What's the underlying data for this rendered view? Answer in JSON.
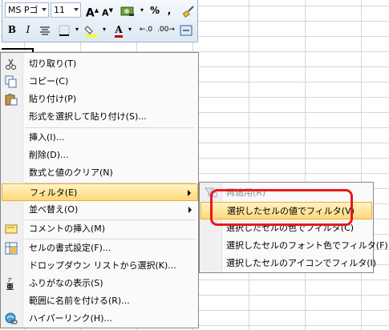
{
  "mini_toolbar": {
    "font_name": "MS Pゴ",
    "font_size": "11",
    "bold": "B",
    "italic": "I",
    "font_color_letter": "A",
    "grow_font": "A",
    "shrink_font": "A",
    "percent": "%",
    "comma": ","
  },
  "context_menu": {
    "items": [
      {
        "label": "切り取り(T)",
        "icon": "scissors-icon"
      },
      {
        "label": "コピー(C)",
        "icon": "copy-icon"
      },
      {
        "label": "貼り付け(P)",
        "icon": "paste-icon"
      },
      {
        "label": "形式を選択して貼り付け(S)..."
      },
      {
        "label": "挿入(I)..."
      },
      {
        "label": "削除(D)..."
      },
      {
        "label": "数式と値のクリア(N)"
      },
      {
        "label": "フィルタ(E)",
        "submenu": true
      },
      {
        "label": "並べ替え(O)",
        "submenu": true
      },
      {
        "label": "コメントの挿入(M)",
        "icon": "comment-icon"
      },
      {
        "label": "セルの書式設定(F)...",
        "icon": "format-cells-icon"
      },
      {
        "label": "ドロップダウン リストから選択(K)..."
      },
      {
        "label": "ふりがなの表示(S)",
        "icon": "phonetic-icon"
      },
      {
        "label": "範囲に名前を付ける(R)..."
      },
      {
        "label": "ハイパーリンク(H)...",
        "icon": "hyperlink-icon"
      }
    ]
  },
  "filter_submenu": {
    "items": [
      {
        "label": "再適用(R)",
        "disabled": true,
        "icon": "reapply-filter-icon"
      },
      {
        "label": "選択したセルの値でフィルタ(V)",
        "highlighted": true
      },
      {
        "label": "選択したセルの色でフィルタ(C)"
      },
      {
        "label": "選択したセルのフォント色でフィルタ(F)"
      },
      {
        "label": "選択したセルのアイコンでフィルタ(I)"
      }
    ]
  },
  "colors": {
    "highlight": "#ffd87a",
    "annotation": "#e8181c",
    "font_color_bar": "#c00000",
    "fill_color_bar": "#ffff00"
  }
}
